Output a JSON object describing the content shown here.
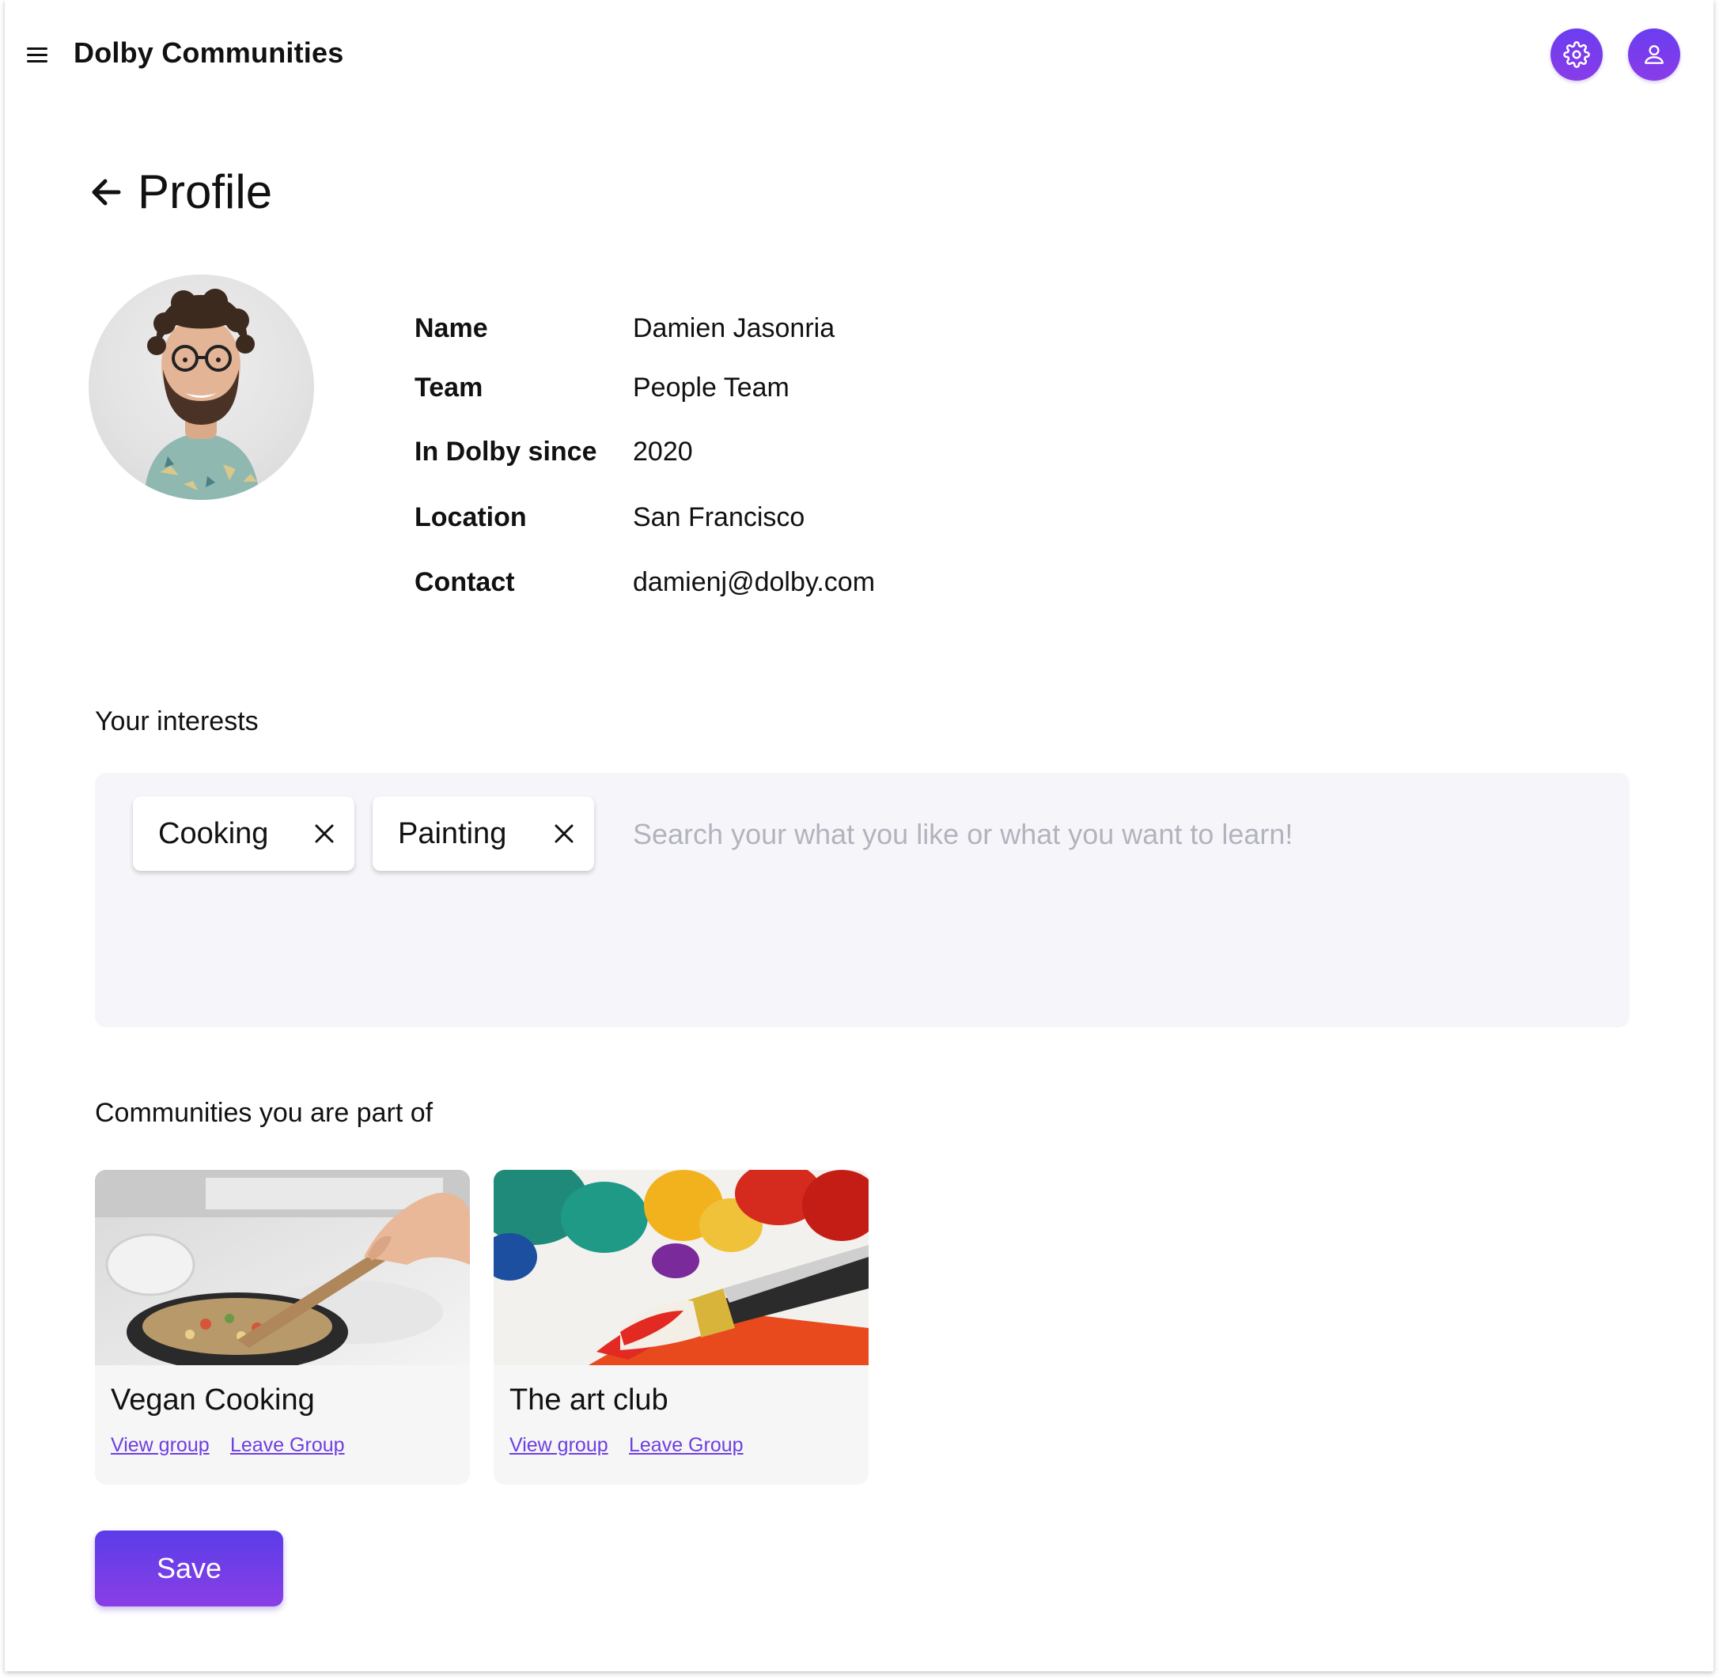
{
  "header": {
    "app_title": "Dolby Communities"
  },
  "page": {
    "title": "Profile"
  },
  "profile": {
    "fields": [
      {
        "label": "Name",
        "value": "Damien Jasonria"
      },
      {
        "label": "Team",
        "value": "People Team"
      },
      {
        "label": "In Dolby since",
        "value": "2020"
      },
      {
        "label": "Location",
        "value": "San Francisco"
      },
      {
        "label": "Contact",
        "value": "damienj@dolby.com"
      }
    ]
  },
  "interests": {
    "heading": "Your interests",
    "chips": [
      {
        "label": "Cooking"
      },
      {
        "label": "Painting"
      }
    ],
    "search_placeholder": "Search your what you like or what you want to learn!"
  },
  "communities": {
    "heading": "Communities you are part of",
    "cards": [
      {
        "title": "Vegan Cooking",
        "view_label": "View group",
        "leave_label": "Leave Group"
      },
      {
        "title": "The art club",
        "view_label": "View group",
        "leave_label": "Leave Group"
      }
    ]
  },
  "actions": {
    "save_label": "Save"
  },
  "colors": {
    "accent": "#6a3df0",
    "link": "#6d3fe0",
    "interest_box_bg": "#f6f6fa"
  },
  "icons": {
    "menu": "hamburger-menu-icon",
    "settings": "gear-icon",
    "account": "user-icon",
    "back": "arrow-left-icon",
    "chip_remove": "close-icon"
  }
}
